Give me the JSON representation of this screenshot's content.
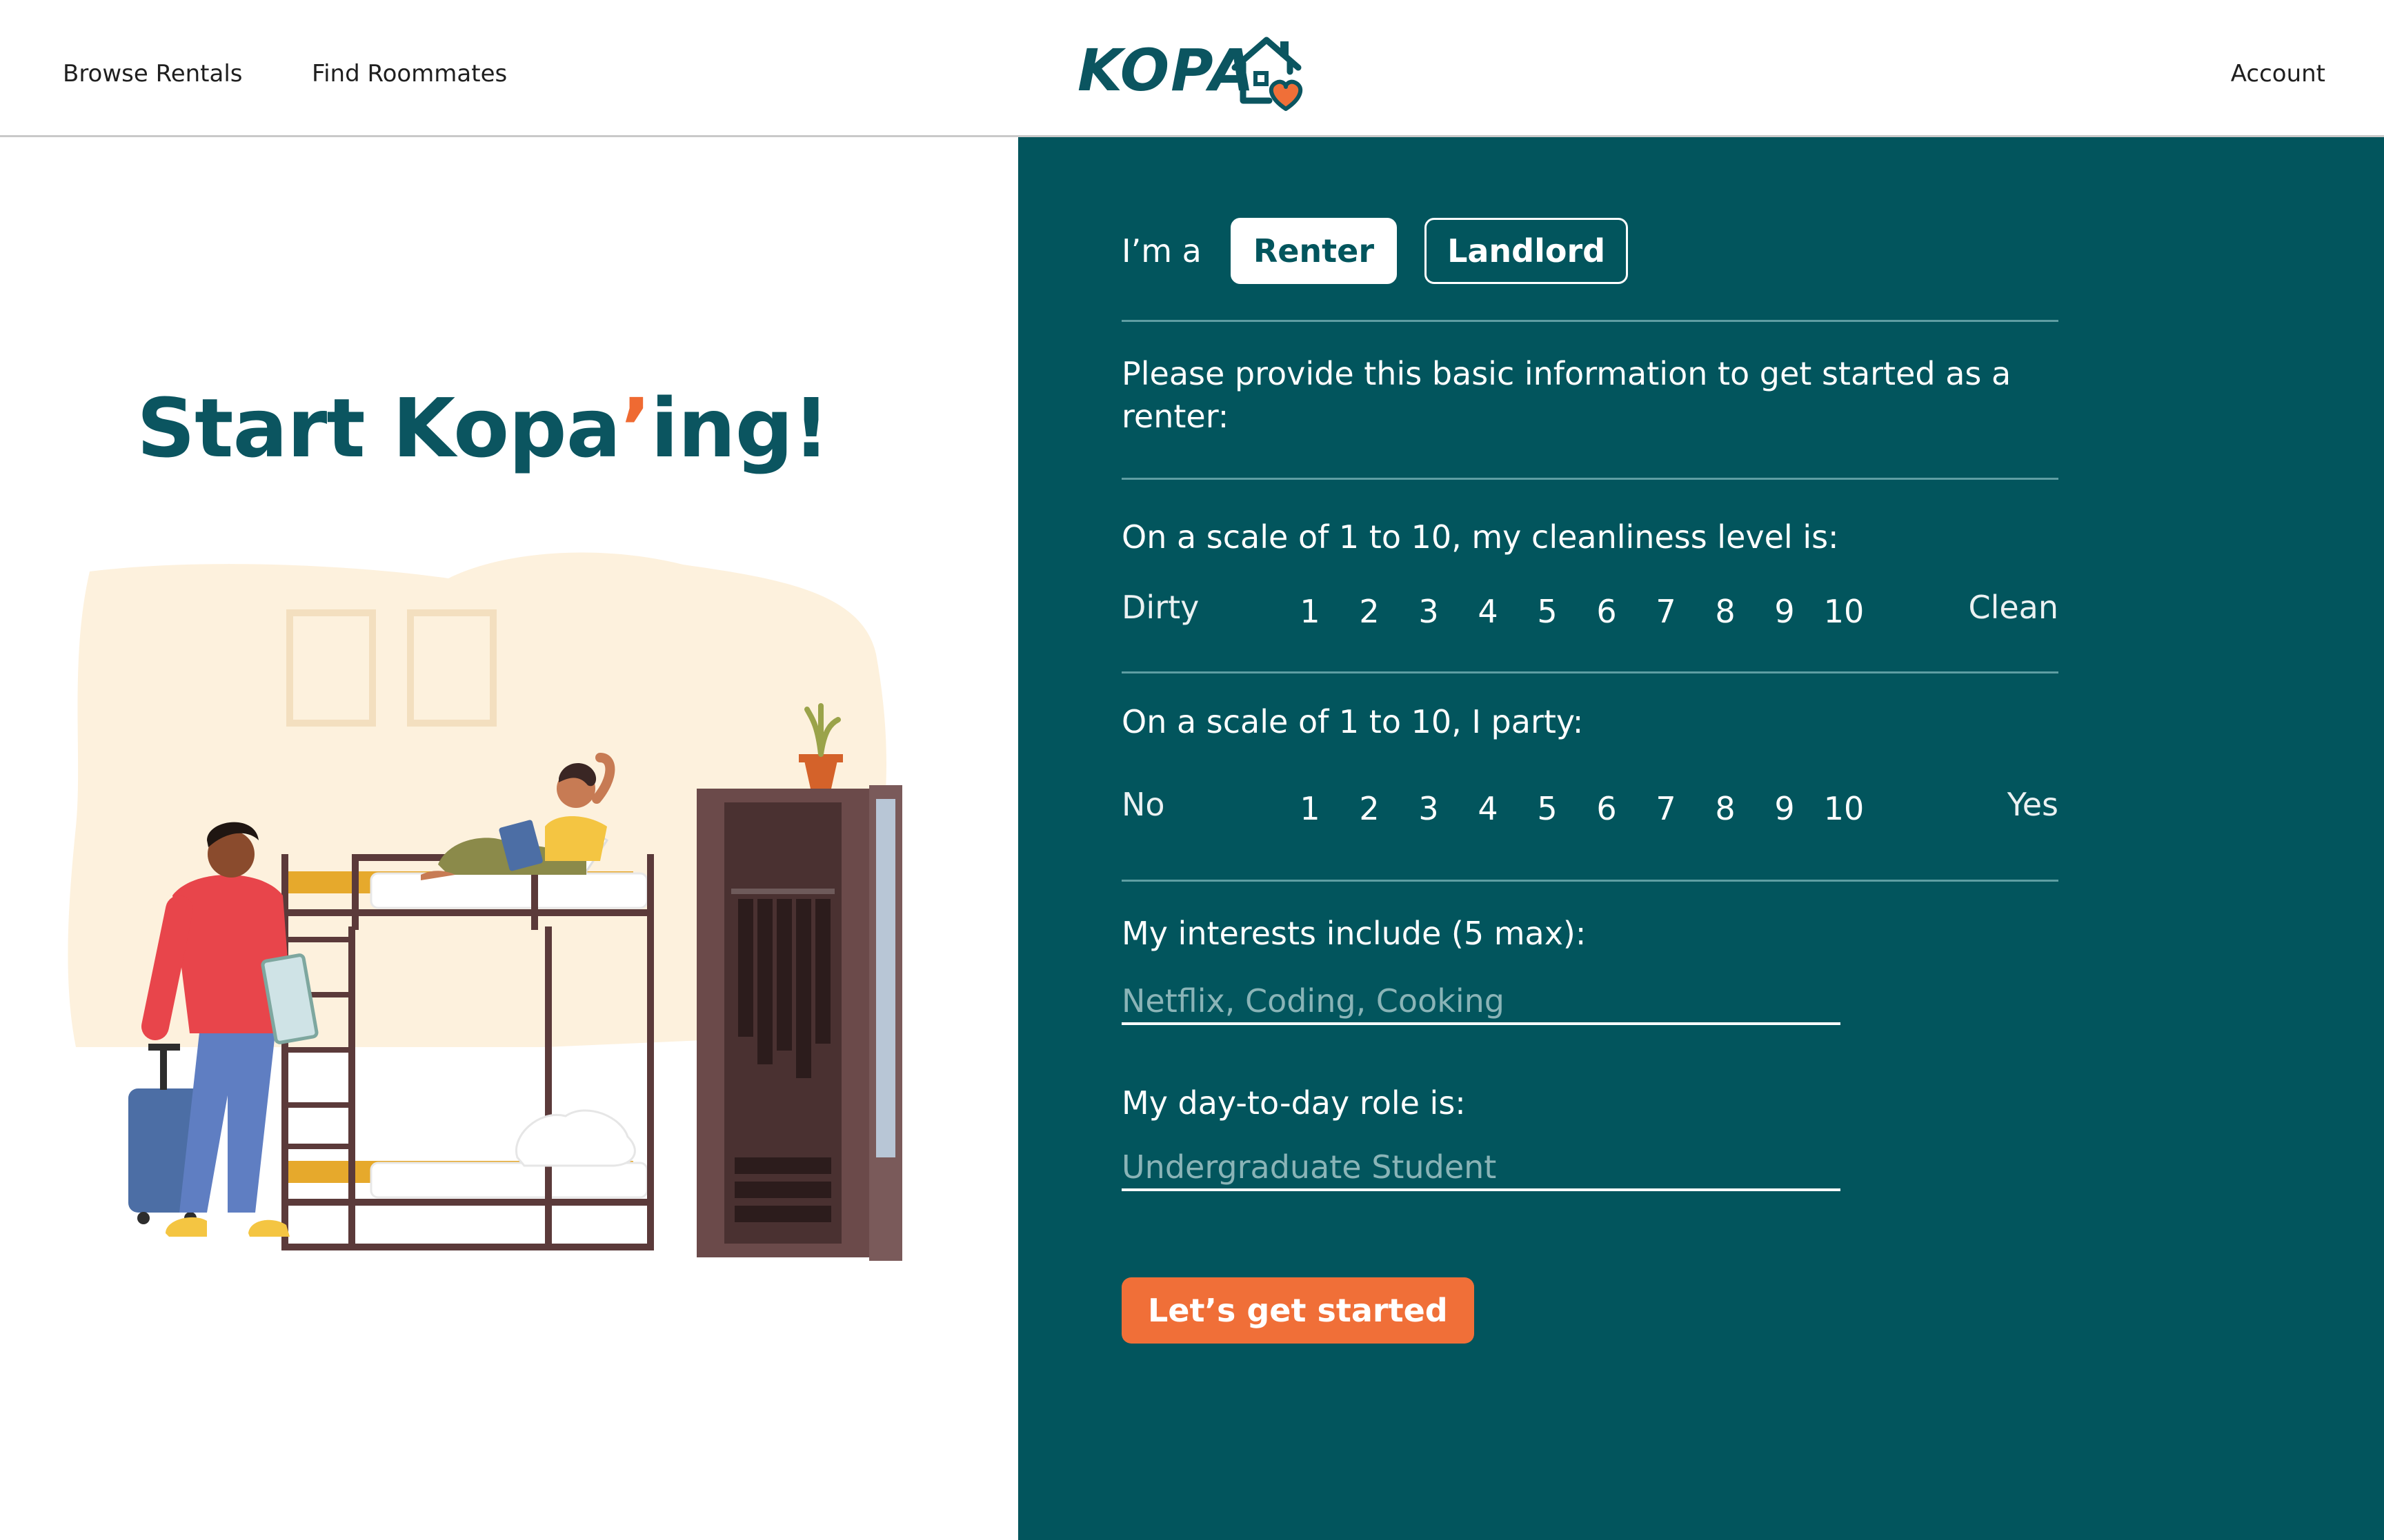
{
  "nav": {
    "browse_rentals": "Browse Rentals",
    "find_roommates": "Find Roommates",
    "account": "Account"
  },
  "logo": {
    "text": "KOPA",
    "icon": "house-heart-icon"
  },
  "hero": {
    "title_part1": "Start Kopa",
    "apostrophe": "’",
    "title_part2": "ing!"
  },
  "form": {
    "role_lead": "I’m a",
    "roles": [
      {
        "label": "Renter",
        "selected": true
      },
      {
        "label": "Landlord",
        "selected": false
      }
    ],
    "intro": "Please provide this basic information to get started as a renter:",
    "cleanliness": {
      "label": "On a scale of 1 to 10, my cleanliness level is:",
      "min_label": "Dirty",
      "max_label": "Clean",
      "values": [
        "1",
        "2",
        "3",
        "4",
        "5",
        "6",
        "7",
        "8",
        "9",
        "10"
      ]
    },
    "party": {
      "label": "On a scale of 1 to 10, I party:",
      "min_label": "No",
      "max_label": "Yes",
      "values": [
        "1",
        "2",
        "3",
        "4",
        "5",
        "6",
        "7",
        "8",
        "9",
        "10"
      ]
    },
    "interests": {
      "label": "My interests include (5 max):",
      "value": "",
      "placeholder": "Netflix, Coding, Cooking"
    },
    "role": {
      "label": "My day-to-day role is:",
      "value": "",
      "placeholder": "Undergraduate Student"
    },
    "submit_label": "Let’s get started"
  },
  "colors": {
    "teal": "#02555d",
    "brand_teal_text": "#0b5560",
    "orange": "#f06f38",
    "divider": "#5f9ea3",
    "placeholder": "#8ab4b7"
  }
}
